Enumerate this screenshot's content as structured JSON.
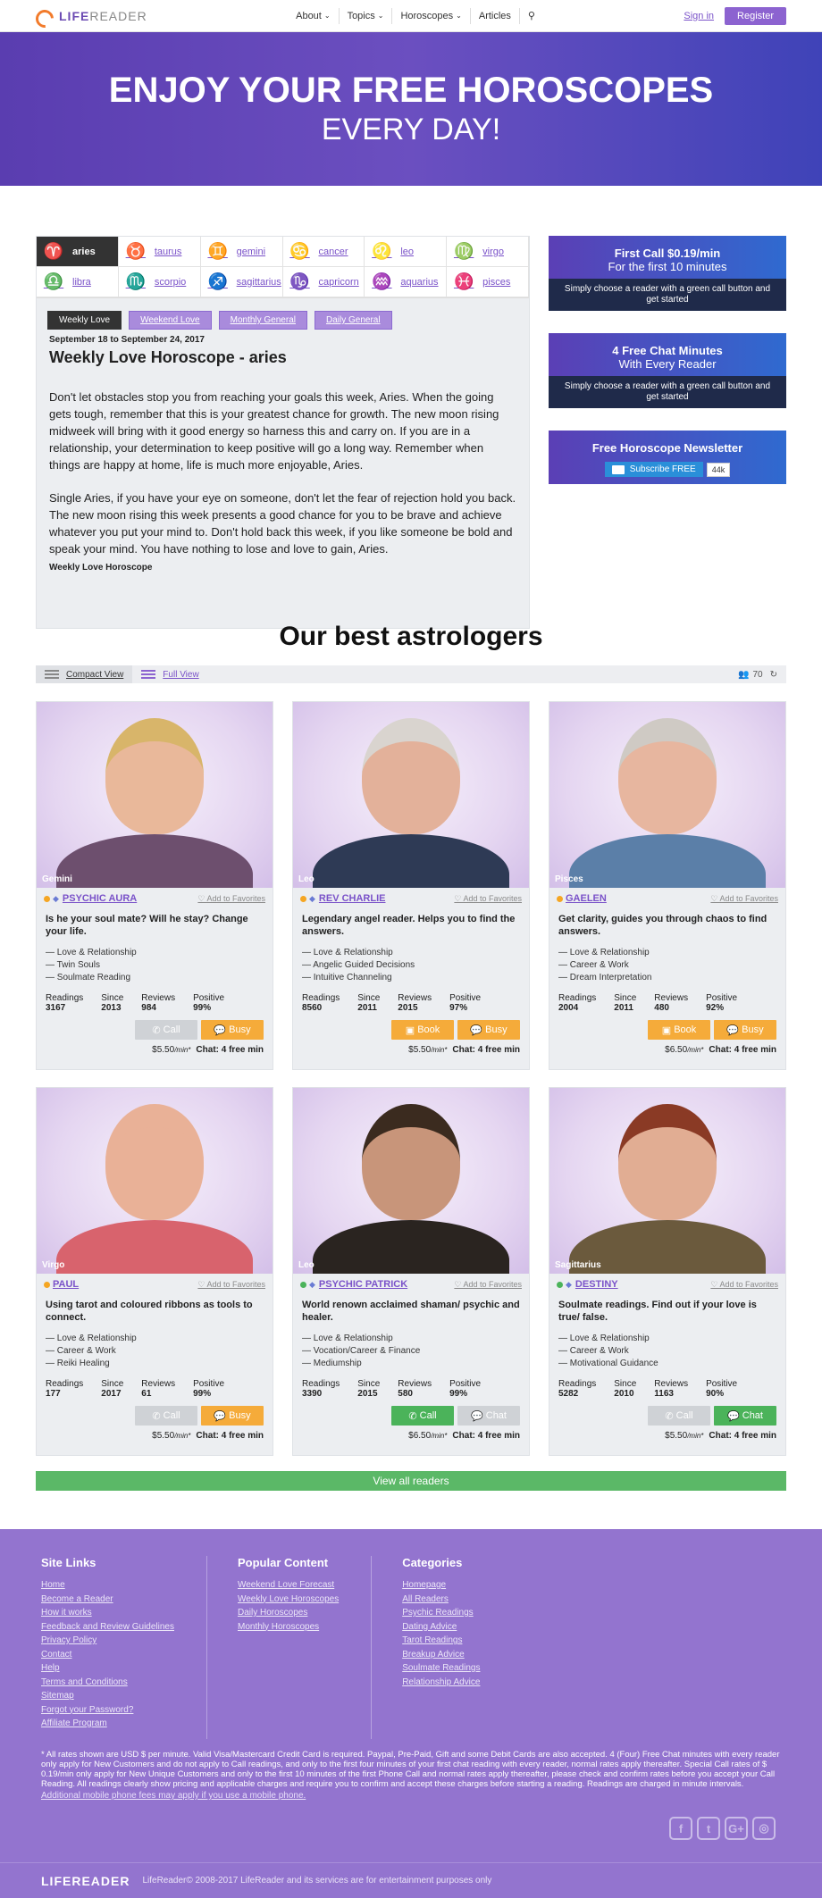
{
  "header": {
    "logo_life": "LIFE",
    "logo_reader": "READER",
    "nav": [
      {
        "label": "About",
        "dropdown": true
      },
      {
        "label": "Topics",
        "dropdown": true
      },
      {
        "label": "Horoscopes",
        "dropdown": true
      },
      {
        "label": "Articles",
        "dropdown": false
      }
    ],
    "signin": "Sign in",
    "register": "Register"
  },
  "hero": {
    "line1": "ENJOY YOUR FREE HOROSCOPES",
    "line2": "EVERY DAY!"
  },
  "signs": [
    {
      "label": "aries",
      "glyph": "♈"
    },
    {
      "label": "taurus",
      "glyph": "♉"
    },
    {
      "label": "gemini",
      "glyph": "♊"
    },
    {
      "label": "cancer",
      "glyph": "♋"
    },
    {
      "label": "leo",
      "glyph": "♌"
    },
    {
      "label": "virgo",
      "glyph": "♍"
    },
    {
      "label": "libra",
      "glyph": "♎"
    },
    {
      "label": "scorpio",
      "glyph": "♏"
    },
    {
      "label": "sagittarius",
      "glyph": "♐"
    },
    {
      "label": "capricorn",
      "glyph": "♑"
    },
    {
      "label": "aquarius",
      "glyph": "♒"
    },
    {
      "label": "pisces",
      "glyph": "♓"
    }
  ],
  "tabs": [
    "Weekly Love",
    "Weekend Love",
    "Monthly General",
    "Daily General"
  ],
  "horoscope": {
    "date": "September 18 to September 24, 2017",
    "title": "Weekly Love Horoscope - aries",
    "p1": "Don't let obstacles stop you from reaching your goals this week, Aries. When the going gets tough, remember that this is your greatest chance for growth. The new moon rising midweek will bring with it good energy so harness this and carry on. If you are in a relationship, your determination to keep positive will go a long way. Remember when things are happy at home, life is much more enjoyable, Aries.",
    "p2": "Single Aries, if you have your eye on someone, don't let the fear of rejection hold you back. The new moon rising this week presents a good chance for you to be brave and achieve whatever you put your mind to. Don't hold back this week, if you like someone be bold and speak your mind. You have nothing to lose and love to gain, Aries.",
    "footer": "Weekly Love Horoscope"
  },
  "promos": [
    {
      "title": "First Call $0.19/min",
      "sub": "For the first 10 minutes",
      "note": "Simply choose a reader with a green call button and get started"
    },
    {
      "title": "4 Free Chat Minutes",
      "sub": "With Every Reader",
      "note": "Simply choose a reader with a green call button and get started"
    }
  ],
  "newsletter": {
    "title": "Free Horoscope Newsletter",
    "button": "Subscribe FREE",
    "count": "44k"
  },
  "best_title": "Our best astrologers",
  "viewbar": {
    "compact": "Compact View",
    "full": "Full View",
    "count": "70"
  },
  "readers": [
    {
      "zodiac": "Gemini",
      "name": "PSYCHIC AURA",
      "status": "#f5a623",
      "diamond": true,
      "tagline": "Is he your soul mate? Will he stay? Change your life.",
      "specs": [
        "— Love & Relationship",
        "— Twin Souls",
        "— Soulmate Reading"
      ],
      "readings": "3167",
      "since": "2013",
      "reviews": "984",
      "positive": "99%",
      "btn1": {
        "label": "Call",
        "style": "gray"
      },
      "btn2": {
        "label": "Busy",
        "style": "orange"
      },
      "price": "$5.50",
      "chat": "Chat: 4 free min",
      "skin": "#e9b89a",
      "hair": "#d8b56a",
      "shirt": "#6d4f6e"
    },
    {
      "zodiac": "Leo",
      "name": "REV CHARLIE",
      "status": "#f5a623",
      "diamond": true,
      "tagline": "Legendary angel reader. Helps you to find the answers.",
      "specs": [
        "— Love & Relationship",
        "— Angelic Guided Decisions",
        "— Intuitive Channeling"
      ],
      "readings": "8560",
      "since": "2011",
      "reviews": "2015",
      "positive": "97%",
      "btn1": {
        "label": "Book",
        "style": "orange"
      },
      "btn2": {
        "label": "Busy",
        "style": "orange"
      },
      "price": "$5.50",
      "chat": "Chat: 4 free min",
      "skin": "#e3b19a",
      "hair": "#d9d4cf",
      "shirt": "#2e3a55"
    },
    {
      "zodiac": "Pisces",
      "name": "GAELEN",
      "status": "#f5a623",
      "diamond": false,
      "tagline": "Get clarity, guides you through chaos to find answers.",
      "specs": [
        "— Love & Relationship",
        "— Career & Work",
        "— Dream Interpretation"
      ],
      "readings": "2004",
      "since": "2011",
      "reviews": "480",
      "positive": "92%",
      "btn1": {
        "label": "Book",
        "style": "orange"
      },
      "btn2": {
        "label": "Busy",
        "style": "orange"
      },
      "price": "$6.50",
      "chat": "Chat: 4 free min",
      "skin": "#e7b69f",
      "hair": "#cfcac4",
      "shirt": "#5b7fa8"
    },
    {
      "zodiac": "Virgo",
      "name": "PAUL",
      "status": "#f5a623",
      "diamond": false,
      "tagline": "Using tarot and coloured ribbons as tools to connect.",
      "specs": [
        "— Love & Relationship",
        "— Career & Work",
        "— Reiki Healing"
      ],
      "readings": "177",
      "since": "2017",
      "reviews": "61",
      "positive": "99%",
      "btn1": {
        "label": "Call",
        "style": "gray"
      },
      "btn2": {
        "label": "Busy",
        "style": "orange"
      },
      "price": "$5.50",
      "chat": "Chat: 4 free min",
      "skin": "#e9b197",
      "hair": "#e9b197",
      "shirt": "#d8636d"
    },
    {
      "zodiac": "Leo",
      "name": "PSYCHIC PATRICK",
      "status": "#4bb35a",
      "diamond": true,
      "tagline": "World renown acclaimed shaman/ psychic and healer.",
      "specs": [
        "— Love & Relationship",
        "— Vocation/Career & Finance",
        "— Mediumship"
      ],
      "readings": "3390",
      "since": "2015",
      "reviews": "580",
      "positive": "99%",
      "btn1": {
        "label": "Call",
        "style": "green"
      },
      "btn2": {
        "label": "Chat",
        "style": "gray"
      },
      "price": "$6.50",
      "chat": "Chat: 4 free min",
      "skin": "#c8957a",
      "hair": "#3b2b1f",
      "shirt": "#2a2420"
    },
    {
      "zodiac": "Sagittarius",
      "name": "DESTINY",
      "status": "#4bb35a",
      "diamond": true,
      "tagline": "Soulmate readings. Find out if your love is true/ false.",
      "specs": [
        "— Love & Relationship",
        "— Career & Work",
        "— Motivational Guidance"
      ],
      "readings": "5282",
      "since": "2010",
      "reviews": "1163",
      "positive": "90%",
      "btn1": {
        "label": "Call",
        "style": "gray"
      },
      "btn2": {
        "label": "Chat",
        "style": "green"
      },
      "price": "$5.50",
      "chat": "Chat: 4 free min",
      "skin": "#e1ad93",
      "hair": "#8a3a25",
      "shirt": "#6b5a3d"
    }
  ],
  "labels": {
    "readings": "Readings",
    "since": "Since",
    "reviews": "Reviews",
    "positive": "Positive",
    "add_fav": "Add to Favorites",
    "per_min": "/min*"
  },
  "view_all": "View all readers",
  "footer": {
    "cols": [
      {
        "title": "Site Links",
        "links": [
          "Home",
          "Become a Reader",
          "How it works",
          "Feedback and Review Guidelines",
          "Privacy Policy",
          "Contact",
          "Help",
          "Terms and Conditions",
          "Sitemap",
          "Forgot your Password?",
          "Affiliate Program"
        ]
      },
      {
        "title": "Popular Content",
        "links": [
          "Weekend Love Forecast",
          "Weekly Love Horoscopes",
          "Daily Horoscopes",
          "Monthly Horoscopes"
        ]
      },
      {
        "title": "Categories",
        "links": [
          "Homepage",
          "All Readers",
          "Psychic Readings",
          "Dating Advice",
          "Tarot Readings",
          "Breakup Advice",
          "Soulmate Readings",
          "Relationship Advice"
        ]
      }
    ],
    "disclaimer": "* All rates shown are USD $ per minute. Valid Visa/Mastercard Credit Card is required. Paypal, Pre-Paid, Gift and some Debit Cards are also accepted. 4 (Four) Free Chat minutes with every reader only apply for New Customers and do not apply to Call readings, and only to the first four minutes of your first chat reading with every reader, normal rates apply thereafter. Special Call rates of $ 0.19/min only apply for New Unique Customers and only to the first 10 minutes of the first Phone Call and normal rates apply thereafter, please check and confirm rates before you accept your Call Reading. All readings clearly show pricing and applicable charges and require you to confirm and accept these charges before starting a reading. Readings are charged in minute intervals.",
    "mobile": "Additional mobile phone fees may apply if you use a mobile phone.",
    "social": [
      "f",
      "t",
      "G+",
      "◎"
    ],
    "logo": "LIFEREADER",
    "copyright": "LifeReader© 2008-2017 LifeReader and its services are for entertainment purposes only"
  }
}
